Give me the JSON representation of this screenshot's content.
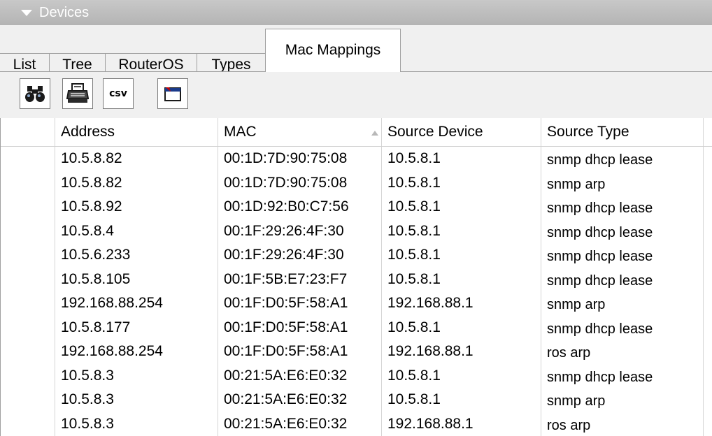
{
  "pane": {
    "title": "Devices"
  },
  "tabs": [
    {
      "label": "List",
      "active": false
    },
    {
      "label": "Tree",
      "active": false
    },
    {
      "label": "RouterOS",
      "active": false
    },
    {
      "label": "Types",
      "active": false
    },
    {
      "label": "Mac Mappings",
      "active": true
    }
  ],
  "toolbar": {
    "find_icon": "binoculars-icon",
    "print_icon": "printer-icon",
    "csv_label": "csv",
    "columns_icon": "window-columns-icon"
  },
  "table": {
    "columns": [
      "",
      "Address",
      "MAC",
      "Source Device",
      "Source Type"
    ],
    "sorted_column": "MAC",
    "rows": [
      {
        "address": "10.5.8.82",
        "mac": "00:1D:7D:90:75:08",
        "source_device": "10.5.8.1",
        "source_type": "snmp dhcp lease"
      },
      {
        "address": "10.5.8.82",
        "mac": "00:1D:7D:90:75:08",
        "source_device": "10.5.8.1",
        "source_type": "snmp arp"
      },
      {
        "address": "10.5.8.92",
        "mac": "00:1D:92:B0:C7:56",
        "source_device": "10.5.8.1",
        "source_type": "snmp dhcp lease"
      },
      {
        "address": "10.5.8.4",
        "mac": "00:1F:29:26:4F:30",
        "source_device": "10.5.8.1",
        "source_type": "snmp dhcp lease"
      },
      {
        "address": "10.5.6.233",
        "mac": "00:1F:29:26:4F:30",
        "source_device": "10.5.8.1",
        "source_type": "snmp dhcp lease"
      },
      {
        "address": "10.5.8.105",
        "mac": "00:1F:5B:E7:23:F7",
        "source_device": "10.5.8.1",
        "source_type": "snmp dhcp lease"
      },
      {
        "address": "192.168.88.254",
        "mac": "00:1F:D0:5F:58:A1",
        "source_device": "192.168.88.1",
        "source_type": "snmp arp"
      },
      {
        "address": "10.5.8.177",
        "mac": "00:1F:D0:5F:58:A1",
        "source_device": "10.5.8.1",
        "source_type": "snmp dhcp lease"
      },
      {
        "address": "192.168.88.254",
        "mac": "00:1F:D0:5F:58:A1",
        "source_device": "192.168.88.1",
        "source_type": "ros arp"
      },
      {
        "address": "10.5.8.3",
        "mac": "00:21:5A:E6:E0:32",
        "source_device": "10.5.8.1",
        "source_type": "snmp dhcp lease"
      },
      {
        "address": "10.5.8.3",
        "mac": "00:21:5A:E6:E0:32",
        "source_device": "10.5.8.1",
        "source_type": "snmp arp"
      },
      {
        "address": "10.5.8.3",
        "mac": "00:21:5A:E6:E0:32",
        "source_device": "192.168.88.1",
        "source_type": "ros arp"
      }
    ]
  },
  "colors": {
    "header_bg": "#b4b4b4",
    "chrome_bg": "#f0f0f0",
    "grid_line": "#d5d5d5"
  }
}
